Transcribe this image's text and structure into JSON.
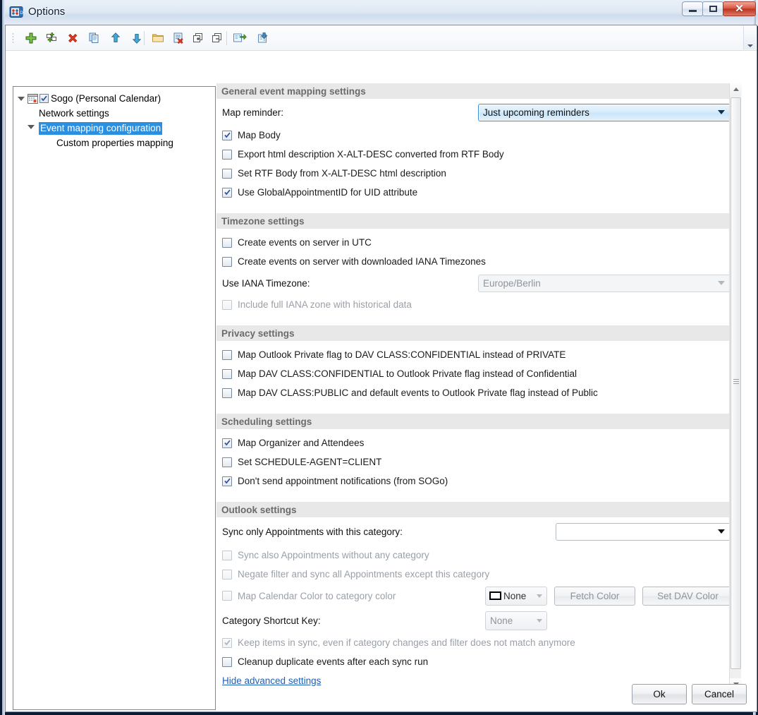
{
  "window": {
    "title": "Options",
    "icon": "app-options-icon",
    "buttons": {
      "minimize": "minimize",
      "maximize": "maximize",
      "close": "close"
    }
  },
  "toolbar": {
    "items": [
      {
        "name": "add-icon",
        "title": "Add"
      },
      {
        "name": "add-group-icon",
        "title": "Add group"
      },
      {
        "name": "delete-icon",
        "title": "Delete"
      },
      {
        "name": "copy-icon",
        "title": "Copy"
      },
      {
        "name": "move-up-icon",
        "title": "Move up"
      },
      {
        "name": "move-down-icon",
        "title": "Move down"
      },
      {
        "name": "folder-icon",
        "title": "Folder"
      },
      {
        "name": "remove-list-icon",
        "title": "Remove list"
      },
      {
        "name": "expand-all-icon",
        "title": "Expand all"
      },
      {
        "name": "collapse-all-icon",
        "title": "Collapse all"
      },
      {
        "name": "export-icon",
        "title": "Export"
      },
      {
        "name": "import-icon",
        "title": "Import"
      }
    ],
    "overflow": "toolbar-overflow-chevron"
  },
  "tree": {
    "items": [
      {
        "label": "Sogo (Personal Calendar)",
        "indent": 0,
        "expander": "open",
        "checkbox": true,
        "checked": true,
        "icon": "calendar-icon",
        "selected": false
      },
      {
        "label": "Network settings",
        "indent": 1,
        "expander": "none",
        "checkbox": false,
        "checked": false,
        "icon": "none",
        "selected": false
      },
      {
        "label": "Event mapping configuration",
        "indent": 0,
        "expander": "open",
        "checkbox": false,
        "checked": false,
        "icon": "none",
        "selected": true
      },
      {
        "label": "Custom properties mapping",
        "indent": 2,
        "expander": "none",
        "checkbox": false,
        "checked": false,
        "icon": "none",
        "selected": false
      }
    ]
  },
  "sections": {
    "general": {
      "header": "General event mapping settings",
      "map_reminder_label": "Map reminder:",
      "map_reminder_value": "Just upcoming reminders",
      "checkboxes": [
        {
          "label": "Map Body",
          "checked": true,
          "disabled": false
        },
        {
          "label": "Export html description X-ALT-DESC converted from RTF Body",
          "checked": false,
          "disabled": false
        },
        {
          "label": "Set RTF Body from X-ALT-DESC html description",
          "checked": false,
          "disabled": false
        },
        {
          "label": "Use GlobalAppointmentID for UID attribute",
          "checked": true,
          "disabled": false
        }
      ]
    },
    "timezone": {
      "header": "Timezone settings",
      "checkboxes_top": [
        {
          "label": "Create events on server in UTC",
          "checked": false,
          "disabled": false
        },
        {
          "label": "Create events on server with downloaded IANA Timezones",
          "checked": false,
          "disabled": false
        }
      ],
      "iana_label": "Use IANA Timezone:",
      "iana_value": "Europe/Berlin",
      "checkboxes_bottom": [
        {
          "label": "Include full IANA zone with historical data",
          "checked": false,
          "disabled": true
        }
      ]
    },
    "privacy": {
      "header": "Privacy settings",
      "checkboxes": [
        {
          "label": "Map Outlook Private flag to DAV CLASS:CONFIDENTIAL instead of PRIVATE",
          "checked": false,
          "disabled": false
        },
        {
          "label": "Map DAV CLASS:CONFIDENTIAL to Outlook Private flag instead of Confidential",
          "checked": false,
          "disabled": false
        },
        {
          "label": "Map DAV CLASS:PUBLIC and default events to Outlook Private flag instead of Public",
          "checked": false,
          "disabled": false
        }
      ]
    },
    "scheduling": {
      "header": "Scheduling settings",
      "checkboxes": [
        {
          "label": "Map Organizer and Attendees",
          "checked": true,
          "disabled": false
        },
        {
          "label": "Set SCHEDULE-AGENT=CLIENT",
          "checked": false,
          "disabled": false
        },
        {
          "label": "Don't send appointment notifications (from SOGo)",
          "checked": true,
          "disabled": false
        }
      ]
    },
    "outlook": {
      "header": "Outlook settings",
      "category_label": "Sync only Appointments with this category:",
      "category_value": "",
      "checkboxes_mid": [
        {
          "label": "Sync also Appointments without any category",
          "checked": false,
          "disabled": true
        },
        {
          "label": "Negate filter and sync all Appointments except this category",
          "checked": false,
          "disabled": true
        }
      ],
      "map_color_label": "Map Calendar Color to category color",
      "map_color_checked": false,
      "map_color_disabled": true,
      "color_value": "None",
      "fetch_color_label": "Fetch Color",
      "set_dav_color_label": "Set DAV Color",
      "shortcut_label": "Category Shortcut Key:",
      "shortcut_value": "None",
      "checkboxes_end": [
        {
          "label": "Keep items in sync, even if category changes and filter does not match anymore",
          "checked": true,
          "disabled": true
        },
        {
          "label": "Cleanup duplicate events after each sync run",
          "checked": false,
          "disabled": false
        }
      ]
    }
  },
  "advanced_link": "Hide advanced settings",
  "footer": {
    "ok": "Ok",
    "cancel": "Cancel"
  }
}
